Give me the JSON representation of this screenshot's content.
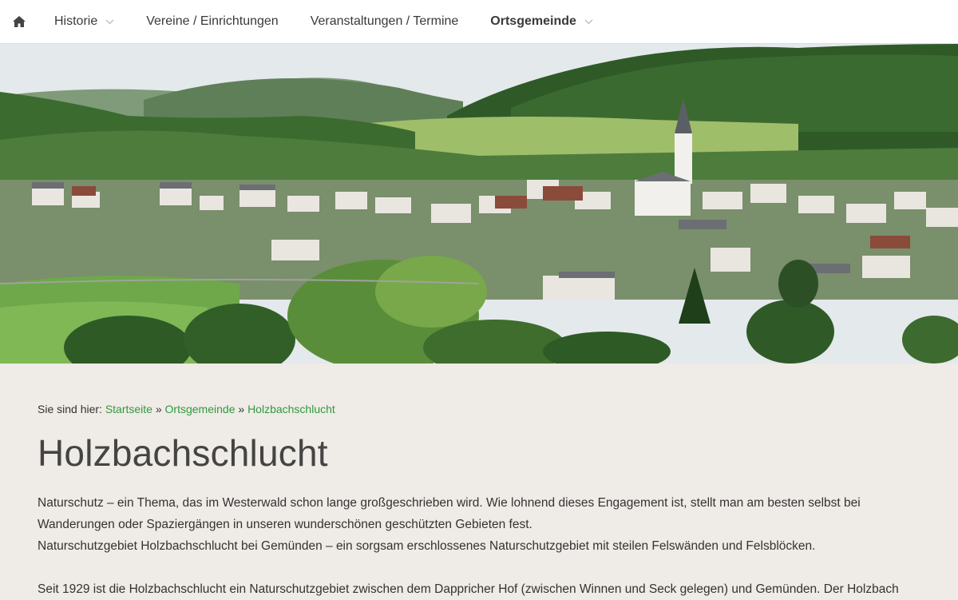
{
  "nav": {
    "home_icon": "home-icon",
    "items": [
      {
        "label": "Historie",
        "has_dropdown": true,
        "bold": false
      },
      {
        "label": "Vereine / Einrichtungen",
        "has_dropdown": false,
        "bold": false
      },
      {
        "label": "Veranstaltungen / Termine",
        "has_dropdown": false,
        "bold": false
      },
      {
        "label": "Ortsgemeinde",
        "has_dropdown": true,
        "bold": true
      }
    ]
  },
  "hero": {
    "alt_icon": "village-landscape-image"
  },
  "breadcrumb": {
    "prefix": "Sie sind hier:",
    "links": [
      "Startseite",
      "Ortsgemeinde",
      "Holzbachschlucht"
    ],
    "separator": "»"
  },
  "page": {
    "title": "Holzbachschlucht",
    "para1_line1": "Naturschutz – ein Thema, das im Westerwald schon lange großgeschrieben wird. Wie lohnend dieses Engagement ist, stellt man am besten selbst bei",
    "para1_line2": "Wanderungen oder Spaziergängen in unseren wunderschönen geschützten Gebieten fest.",
    "para1_line3": "Naturschutzgebiet Holzbachschlucht bei Gemünden – ein sorgsam erschlossenes Naturschutzgebiet mit steilen Felswänden und Felsblöcken.",
    "para2_line1": "Seit 1929 ist die Holzbachschlucht ein Naturschutzgebiet zwischen dem Dappricher Hof (zwischen Winnen und Seck gelegen) und Gemünden. Der Holzbach"
  },
  "colors": {
    "link": "#2f9a3f",
    "background": "#efebe6",
    "nav_bg": "#ffffff"
  }
}
